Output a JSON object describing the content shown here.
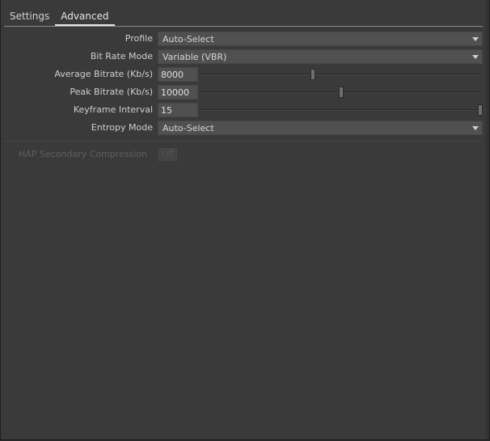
{
  "tabs": [
    {
      "label": "Settings",
      "active": false
    },
    {
      "label": "Advanced",
      "active": true
    }
  ],
  "fields": {
    "profile": {
      "label": "Profile",
      "value": "Auto-Select"
    },
    "bit_rate_mode": {
      "label": "Bit Rate Mode",
      "value": "Variable (VBR)"
    },
    "average_bitrate": {
      "label": "Average Bitrate (Kb/s)",
      "value": "8000",
      "slider_fraction": 0.4
    },
    "peak_bitrate": {
      "label": "Peak Bitrate (Kb/s)",
      "value": "10000",
      "slider_fraction": 0.5
    },
    "keyframe_interval": {
      "label": "Keyframe Interval",
      "value": "15",
      "slider_fraction": 1.0
    },
    "entropy_mode": {
      "label": "Entropy Mode",
      "value": "Auto-Select"
    }
  },
  "hap": {
    "label": "HAP Secondary Compression",
    "toggle_value": "Off",
    "enabled": false
  },
  "colors": {
    "panel_background": "#3a3a3a",
    "field_background": "#505050",
    "label_text": "#cfcfcf",
    "disabled_text": "#5f5f5f"
  }
}
